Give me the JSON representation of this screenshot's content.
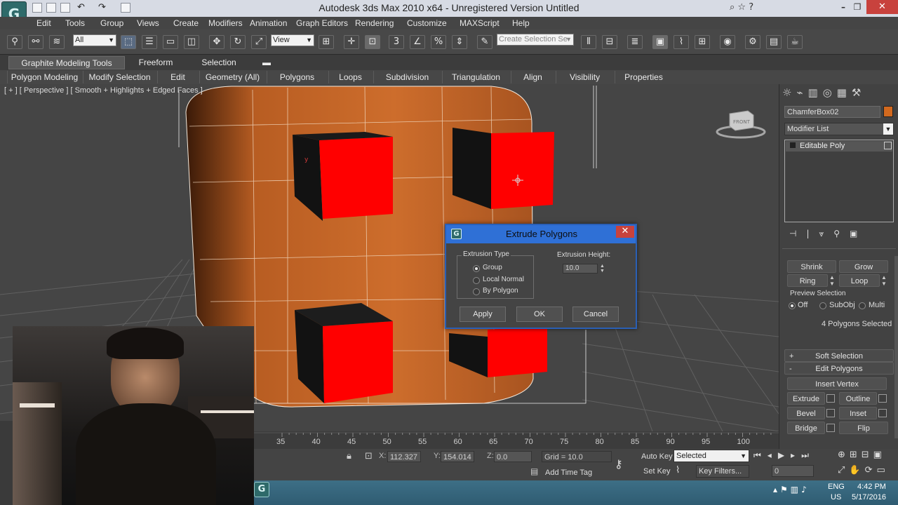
{
  "window": {
    "title": "Autodesk 3ds Max  2010 x64  - Unregistered Version    Untitled"
  },
  "menubar": [
    "Edit",
    "Tools",
    "Group",
    "Views",
    "Create",
    "Modifiers",
    "Animation",
    "Graph Editors",
    "Rendering",
    "Customize",
    "MAXScript",
    "Help"
  ],
  "toolbar": {
    "selection_filter": "All",
    "ref_coord": "View",
    "named_selection_placeholder": "Create Selection Se",
    "snap_label": "3"
  },
  "ribbon": {
    "tabs": [
      "Graphite Modeling Tools",
      "Freeform",
      "Selection"
    ],
    "panels": [
      "Polygon Modeling",
      "Modify Selection",
      "Edit",
      "Geometry (All)",
      "Polygons",
      "Loops",
      "Subdivision",
      "Triangulation",
      "Align",
      "Visibility",
      "Properties"
    ]
  },
  "viewport": {
    "label": "[ + ] [ Perspective ] [ Smooth + Highlights + Edged Faces ]",
    "viewcube_label": "FRONT",
    "gizmo_axis": "y"
  },
  "command_panel": {
    "object_name": "ChamferBox02",
    "object_color": "#d2691e",
    "modifier_list": "Modifier List",
    "stack_item": "Editable Poly",
    "selection": {
      "shrink": "Shrink",
      "grow": "Grow",
      "ring": "Ring",
      "loop": "Loop"
    },
    "preview_selection": {
      "label": "Preview Selection",
      "off": "Off",
      "subobj": "SubObj",
      "multi": "Multi"
    },
    "selected_count": "4 Polygons Selected",
    "rollouts": {
      "soft_selection": "Soft Selection",
      "edit_polygons": "Edit Polygons",
      "soft_sign": "+",
      "edit_sign": "-"
    },
    "edit_polygons": {
      "insert_vertex": "Insert Vertex",
      "extrude": "Extrude",
      "outline": "Outline",
      "bevel": "Bevel",
      "inset": "Inset",
      "bridge": "Bridge",
      "flip": "Flip"
    }
  },
  "dialog": {
    "title": "Extrude Polygons",
    "extrusion_type_label": "Extrusion Type",
    "options": [
      "Group",
      "Local Normal",
      "By Polygon"
    ],
    "selected_option": "Group",
    "height_label": "Extrusion Height:",
    "height_value": "10.0",
    "apply": "Apply",
    "ok": "OK",
    "cancel": "Cancel"
  },
  "timeline": {
    "ticks": [
      "35",
      "40",
      "45",
      "50",
      "55",
      "60",
      "65",
      "70",
      "75",
      "80",
      "85",
      "90",
      "95",
      "100"
    ]
  },
  "status": {
    "x_label": "X:",
    "x_value": "112.327",
    "y_label": "Y:",
    "y_value": "154.014",
    "z_label": "Z:",
    "z_value": "0.0",
    "grid": "Grid = 10.0",
    "add_time_tag": "Add Time Tag",
    "auto_key": "Auto Key",
    "set_key": "Set Key",
    "key_mode": "Selected",
    "key_filters": "Key Filters...",
    "frame": "0"
  },
  "taskbar": {
    "lang": "ENG",
    "region": "US",
    "time": "4:42 PM",
    "date": "5/17/2016"
  },
  "colors": {
    "accent": "#2f70d6",
    "object": "#c86a28",
    "selected_faces": "#ff0000",
    "close": "#c8423d"
  }
}
